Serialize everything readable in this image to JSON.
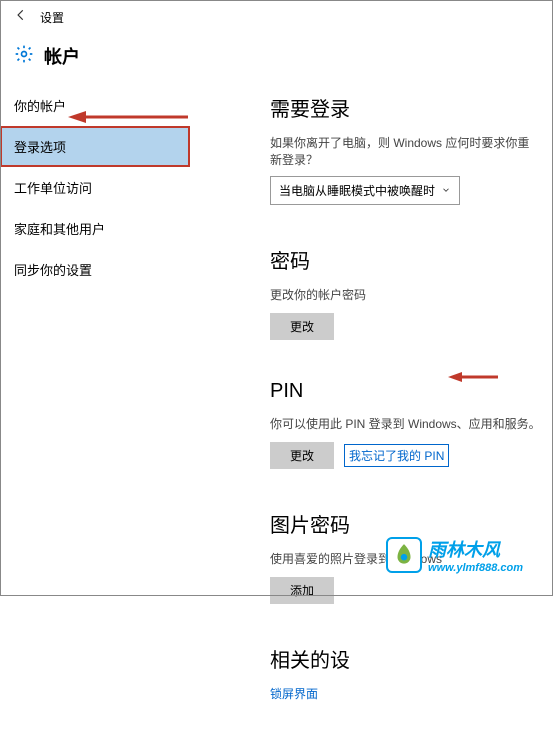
{
  "titlebar": {
    "title": "设置"
  },
  "header": {
    "title": "帐户"
  },
  "sidebar": {
    "items": [
      {
        "label": "你的帐户"
      },
      {
        "label": "登录选项"
      },
      {
        "label": "工作单位访问"
      },
      {
        "label": "家庭和其他用户"
      },
      {
        "label": "同步你的设置"
      }
    ]
  },
  "main": {
    "signin": {
      "title": "需要登录",
      "desc": "如果你离开了电脑，则 Windows 应何时要求你重新登录？",
      "select_value": "当电脑从睡眠模式中被唤醒时"
    },
    "password": {
      "title": "密码",
      "desc": "更改你的帐户密码",
      "change_btn": "更改"
    },
    "pin": {
      "title": "PIN",
      "desc": "你可以使用此 PIN 登录到 Windows、应用和服务。",
      "change_btn": "更改",
      "forgot_link": "我忘记了我的 PIN"
    },
    "picture": {
      "title": "图片密码",
      "desc": "使用喜爱的照片登录到 Windows",
      "add_btn": "添加"
    },
    "related": {
      "title": "相关的设",
      "lockscreen_link": "锁屏界面"
    }
  },
  "watermark": {
    "cn": "雨林木风",
    "url": "www.ylmf888.com"
  }
}
